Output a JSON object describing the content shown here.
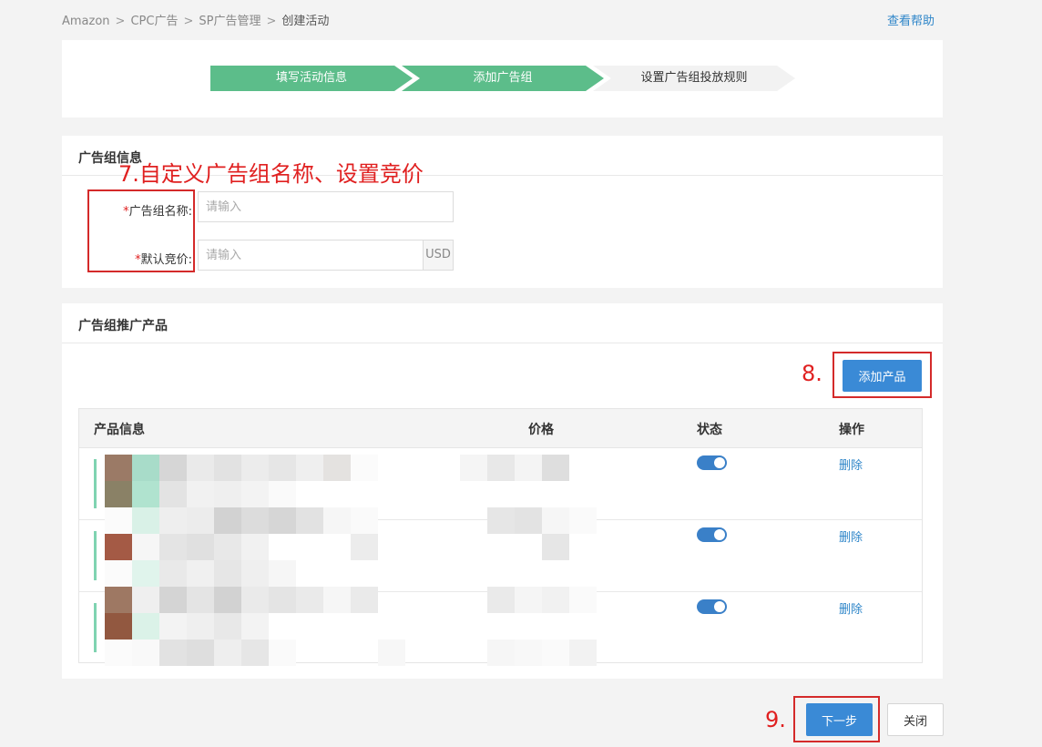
{
  "breadcrumb": {
    "items": [
      "Amazon",
      "CPC广告",
      "SP广告管理",
      "创建活动"
    ],
    "separator": ">"
  },
  "help_link": "查看帮助",
  "steps": [
    {
      "label": "填写活动信息",
      "state": "done"
    },
    {
      "label": "添加广告组",
      "state": "active"
    },
    {
      "label": "设置广告组投放规则",
      "state": "pending"
    }
  ],
  "group_info": {
    "title": "广告组信息",
    "annotation": "7.自定义广告组名称、设置竞价",
    "name_field": {
      "required_mark": "*",
      "label": "广告组名称:",
      "placeholder": "请输入",
      "value": ""
    },
    "bid_field": {
      "required_mark": "*",
      "label": "默认竞价:",
      "placeholder": "请输入",
      "value": "",
      "currency": "USD"
    }
  },
  "products": {
    "title": "广告组推广产品",
    "add_annotation": "8.",
    "add_button": "添加产品",
    "columns": {
      "info": "产品信息",
      "price": "价格",
      "status": "状态",
      "action": "操作"
    },
    "rows": [
      {
        "status_on": true,
        "action": "删除"
      },
      {
        "status_on": true,
        "action": "删除"
      },
      {
        "status_on": true,
        "action": "删除"
      }
    ]
  },
  "footer": {
    "next_annotation": "9.",
    "next_button": "下一步",
    "close_button": "关闭"
  },
  "colors": {
    "step_done": "#5cbd8a",
    "step_pending": "#f2f2f2",
    "primary": "#3a8ad6",
    "link": "#2f86c9",
    "annotation": "#e02020",
    "toggle_on": "#3a80c8"
  }
}
